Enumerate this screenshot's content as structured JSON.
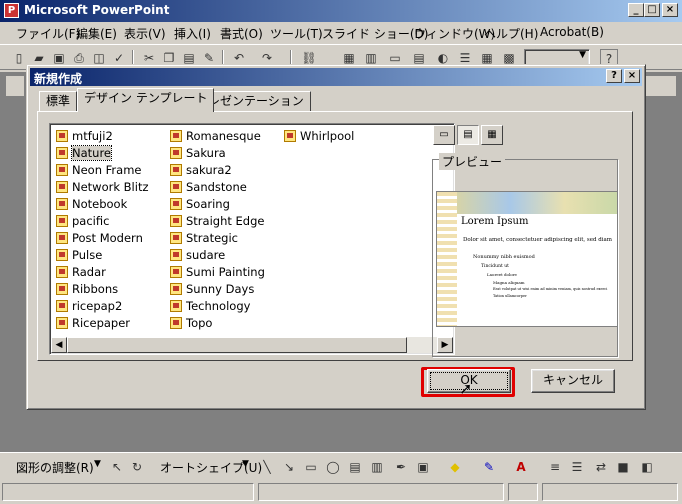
{
  "app": {
    "title": "Microsoft PowerPoint"
  },
  "menu": [
    "ファイル(F)",
    "編集(E)",
    "表示(V)",
    "挿入(I)",
    "書式(O)",
    "ツール(T)",
    "スライド ショー(D)",
    "ウィンドウ(W)",
    "ヘルプ(H)",
    "Acrobat(B)"
  ],
  "dialog": {
    "title": "新規作成",
    "help_btn": "?",
    "close_btn": "×",
    "tabs": [
      "標準",
      "デザイン テンプレート",
      "プレゼンテーション"
    ],
    "active_tab": 1,
    "templates": [
      [
        "mtfuji2",
        "Nature",
        "Neon Frame",
        "Network Blitz",
        "Notebook",
        "pacific",
        "Post Modern",
        "Pulse",
        "Radar",
        "Ribbons",
        "ricepap2",
        "Ricepaper"
      ],
      [
        "Romanesque",
        "Sakura",
        "sakura2",
        "Sandstone",
        "Soaring",
        "Straight Edge",
        "Strategic",
        "sudare",
        "Sumi Painting",
        "Sunny Days",
        "Technology",
        "Topo"
      ],
      [
        "Whirlpool"
      ]
    ],
    "selected_template": "Nature",
    "preview_label": "プレビュー",
    "preview": {
      "slide_title": "Lorem Ipsum",
      "bullet1": "Dolor sit amet, consectetuer adipiscing elit, sed diam",
      "bullet2": "Nonummy nibh euismod",
      "bullet3": "Tincidunt ut",
      "bullet4": "Laoreet dolore",
      "bullet5": "Magna aliquam",
      "bullet6": "Erat volutpat ut wisi enim ad minim veniam, quis nostrud exerci",
      "bullet7": "Tation ullamcorper"
    },
    "ok_label": "OK",
    "cancel_label": "キャンセル"
  },
  "drawbar": {
    "adjust_label": "図形の調整(R)",
    "autoshape_label": "オートシェイプ(U)"
  },
  "colors": {
    "titlebar_start": "#0a246a",
    "titlebar_end": "#a6caf0",
    "highlight": "#e00000",
    "face": "#d4d0c8"
  }
}
